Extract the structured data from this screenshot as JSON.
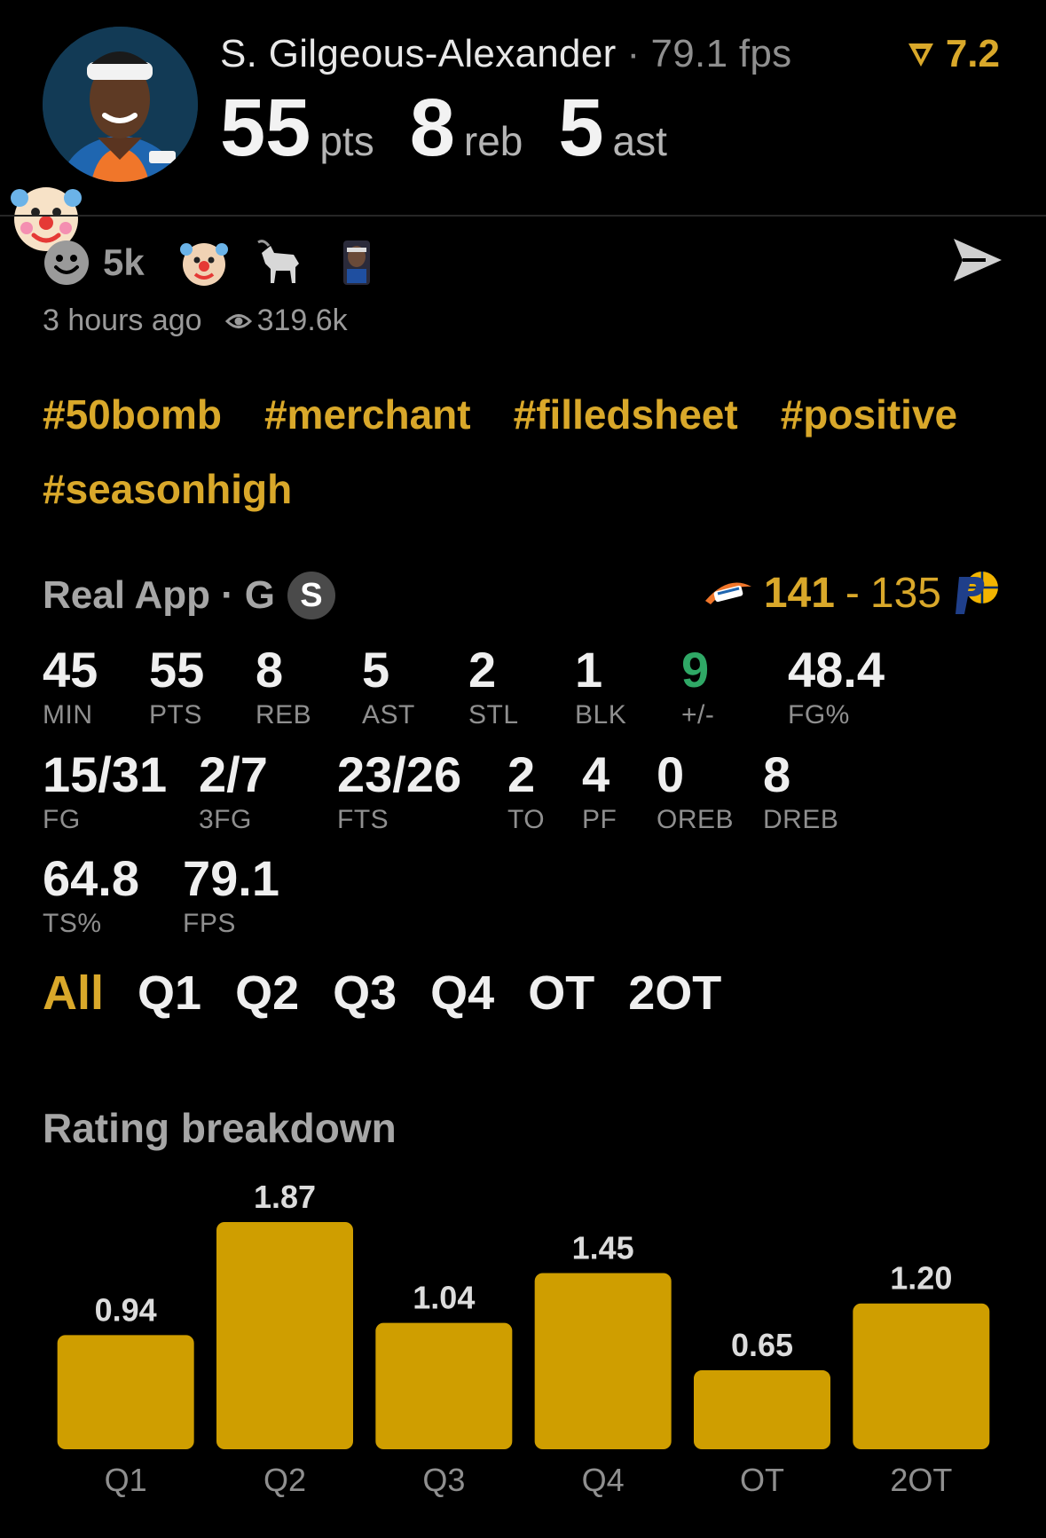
{
  "header": {
    "player_name": "S. Gilgeous-Alexander",
    "separator": "·",
    "fps_text": "79.1 fps",
    "rating": "7.2",
    "pts": "55",
    "pts_unit": "pts",
    "reb": "8",
    "reb_unit": "reb",
    "ast": "5",
    "ast_unit": "ast"
  },
  "reactions": {
    "count": "5k",
    "icons": [
      "smile-icon",
      "clown-icon",
      "goat-icon",
      "player-image-icon"
    ],
    "time_ago": "3 hours ago",
    "views": "319.6k"
  },
  "tags": [
    "#50bomb",
    "#merchant",
    "#filledsheet",
    "#positive",
    "#seasonhigh"
  ],
  "source": {
    "label": "Real App",
    "separator": "·",
    "position": "G",
    "badge": "S"
  },
  "score": {
    "winner": "141",
    "dash": "-",
    "loser": "135"
  },
  "stats": {
    "min": {
      "v": "45",
      "l": "MIN"
    },
    "pts": {
      "v": "55",
      "l": "PTS"
    },
    "reb": {
      "v": "8",
      "l": "REB"
    },
    "ast": {
      "v": "5",
      "l": "AST"
    },
    "stl": {
      "v": "2",
      "l": "STL"
    },
    "blk": {
      "v": "1",
      "l": "BLK"
    },
    "pm": {
      "v": "9",
      "l": "+/-"
    },
    "fgp": {
      "v": "48.4",
      "l": "FG%"
    },
    "fg": {
      "v": "15/31",
      "l": "FG"
    },
    "fg3": {
      "v": "2/7",
      "l": "3FG"
    },
    "fts": {
      "v": "23/26",
      "l": "FTS"
    },
    "to": {
      "v": "2",
      "l": "TO"
    },
    "pf": {
      "v": "4",
      "l": "PF"
    },
    "oreb": {
      "v": "0",
      "l": "OREB"
    },
    "dreb": {
      "v": "8",
      "l": "DREB"
    },
    "tsp": {
      "v": "64.8",
      "l": "TS%"
    },
    "fps": {
      "v": "79.1",
      "l": "FPS"
    }
  },
  "period_tabs": [
    "All",
    "Q1",
    "Q2",
    "Q3",
    "Q4",
    "OT",
    "2OT"
  ],
  "chart_title": "Rating breakdown",
  "colors": {
    "accent": "#d9a82a",
    "bar": "#cf9e00",
    "positive": "#2fa866",
    "background": "#000000"
  },
  "chart_data": {
    "type": "bar",
    "title": "Rating breakdown",
    "categories": [
      "Q1",
      "Q2",
      "Q3",
      "Q4",
      "OT",
      "2OT"
    ],
    "values": [
      0.94,
      1.87,
      1.04,
      1.45,
      0.65,
      1.2
    ],
    "value_labels": [
      "0.94",
      "1.87",
      "1.04",
      "1.45",
      "0.65",
      "1.20"
    ],
    "xlabel": "",
    "ylabel": "",
    "ylim": [
      0,
      1.87
    ],
    "grid": false
  }
}
